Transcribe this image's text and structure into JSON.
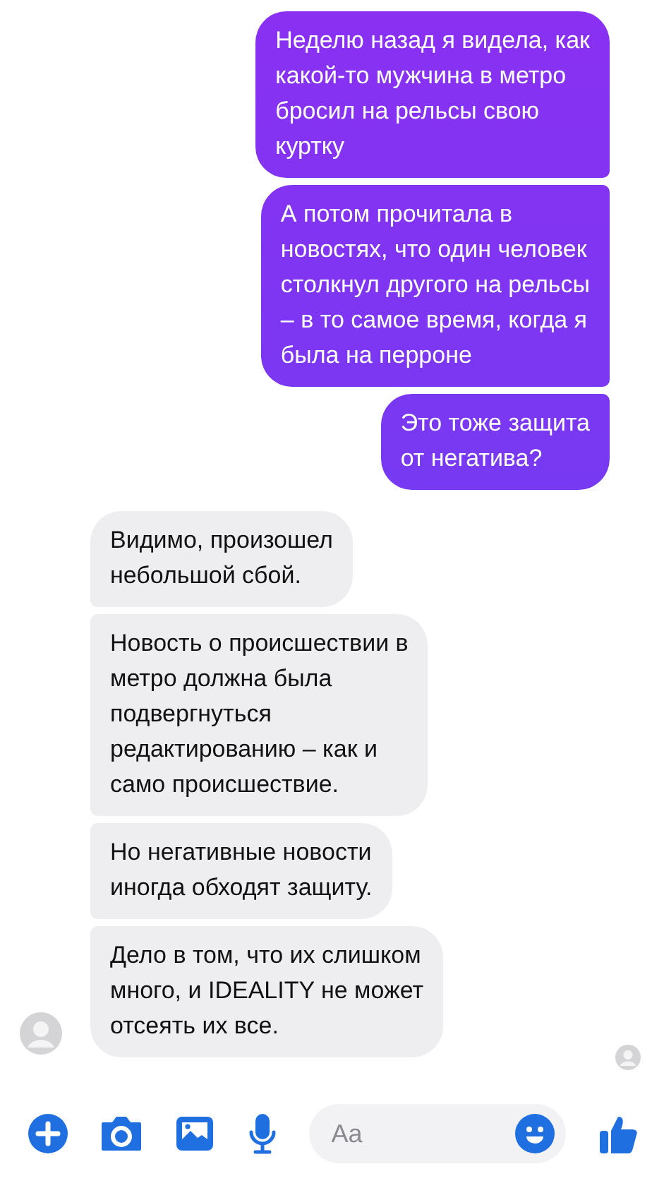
{
  "messages": [
    {
      "kind": "outgoing",
      "text": "Неделю назад я видела, как\nкакой-то мужчина в метро\nбросил на рельсы свою\nкуртку"
    },
    {
      "kind": "outgoing",
      "text": "А потом прочитала в\nновостях, что один человек\nстолкнул другого на рельсы\n– в то самое время, когда я\nбыла на перроне"
    },
    {
      "kind": "outgoing",
      "text": "Это тоже защита\nот негатива?"
    },
    {
      "kind": "incoming",
      "text": "Видимо, произошел\nнебольшой сбой."
    },
    {
      "kind": "incoming",
      "text": "Новость о происшествии в\nметро должна была\nподвергнуться\nредактированию – как и\nсамо происшествие."
    },
    {
      "kind": "incoming",
      "text": "Но негативные новости\nиногда обходят защиту."
    },
    {
      "kind": "incoming",
      "text": "Дело в том, что их слишком\nмного, и IDEALITY не может\nотсеять их все."
    }
  ],
  "composer": {
    "placeholder": "Aa"
  }
}
